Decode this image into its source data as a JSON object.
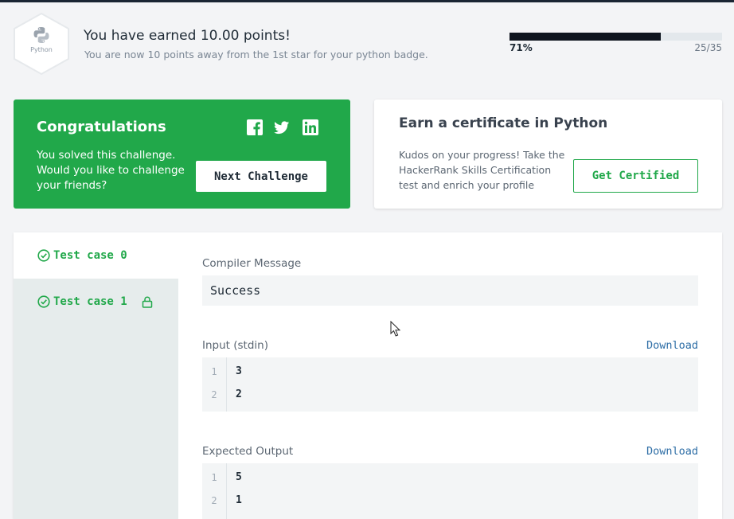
{
  "badge": {
    "label": "Python",
    "icon": "python-logo-icon"
  },
  "header": {
    "title": "You have earned 10.00 points!",
    "subtitle": "You are now 10 points away from the 1st star for your python badge.",
    "progress_percent_label": "71%",
    "progress_fraction": 0.71,
    "progress_count": "25/35"
  },
  "congrats": {
    "title": "Congratulations",
    "message": "You solved this challenge. Would you like to challenge your friends?",
    "share_icons": [
      "facebook-icon",
      "twitter-icon",
      "linkedin-icon"
    ],
    "next_label": "Next Challenge"
  },
  "certificate": {
    "title": "Earn a certificate in Python",
    "message": "Kudos on your progress! Take the HackerRank Skills Certification test and enrich your profile",
    "button_label": "Get Certified"
  },
  "tabs": [
    {
      "label": "Test case 0",
      "active": true,
      "locked": false
    },
    {
      "label": "Test case 1",
      "active": false,
      "locked": true
    }
  ],
  "result": {
    "compiler_label": "Compiler Message",
    "compiler_message": "Success",
    "input_label": "Input (stdin)",
    "input_download": "Download",
    "input_lines": [
      {
        "n": "1",
        "v": "3"
      },
      {
        "n": "2",
        "v": "2"
      }
    ],
    "expected_label": "Expected Output",
    "expected_download": "Download",
    "expected_lines": [
      {
        "n": "1",
        "v": "5"
      },
      {
        "n": "2",
        "v": "1"
      }
    ]
  },
  "colors": {
    "accent_green": "#21a84a",
    "progress_fill": "#0e141e",
    "link_blue": "#2e6ea6",
    "panel_bg": "#e6ecec"
  }
}
